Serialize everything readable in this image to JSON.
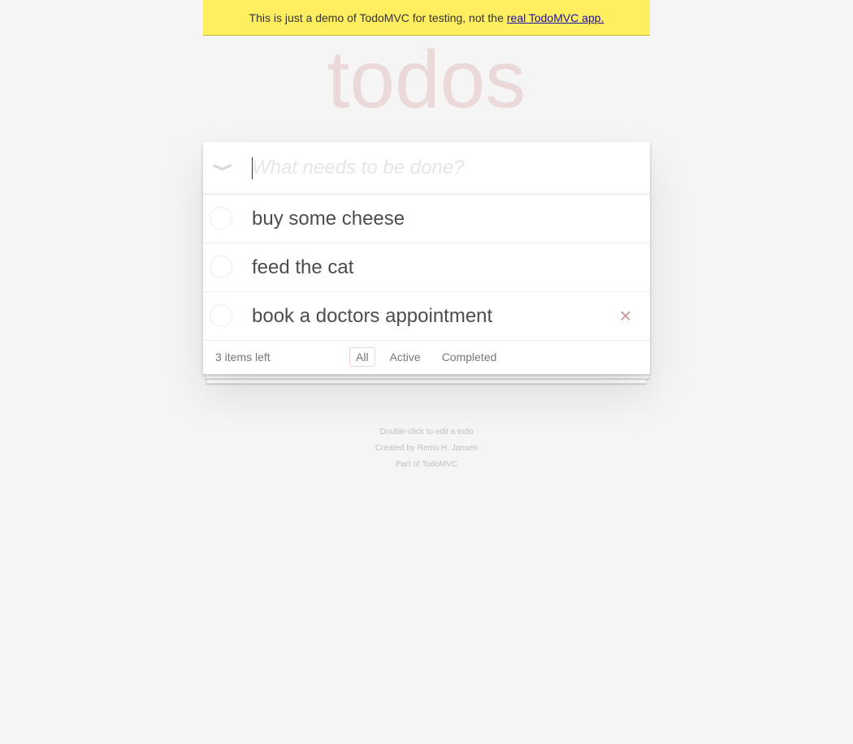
{
  "banner": {
    "text": "This is just a demo of TodoMVC for testing, not the",
    "link_label": "real TodoMVC app."
  },
  "header": {
    "title": "todos"
  },
  "new_todo": {
    "placeholder": "What needs to be done?",
    "value": "",
    "toggle_all_glyph": "❯"
  },
  "todos": [
    {
      "label": "buy some cheese",
      "completed": false
    },
    {
      "label": "feed the cat",
      "completed": false
    },
    {
      "label": "book a doctors appointment",
      "completed": false
    }
  ],
  "destroy_glyph": "×",
  "footer": {
    "count_label": "3 items left",
    "filters": [
      {
        "label": "All",
        "selected": true
      },
      {
        "label": "Active",
        "selected": false
      },
      {
        "label": "Completed",
        "selected": false
      }
    ]
  },
  "info": {
    "line1": "Double-click to edit a todo",
    "line2": "Created by Remo H. Jansen",
    "line3": "Part of TodoMVC"
  },
  "colors": {
    "banner_bg": "#ffee60",
    "title": "#e9d4d4",
    "destroy": "#cc9a9a",
    "page_bg": "#f5f5f5"
  }
}
